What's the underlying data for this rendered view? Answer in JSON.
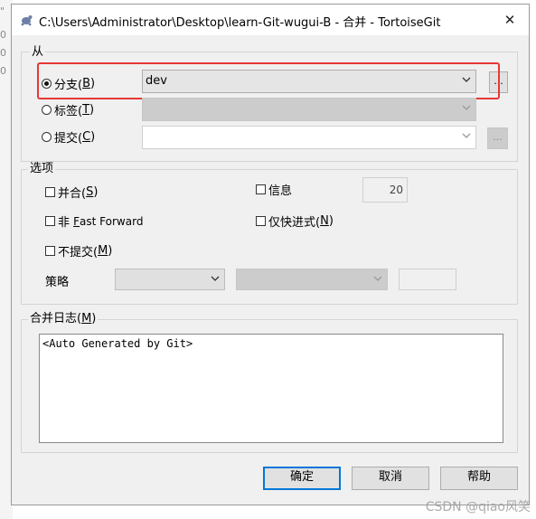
{
  "background": {
    "fragments": [
      "\"",
      "0",
      "0",
      "0"
    ]
  },
  "window": {
    "title": "C:\\Users\\Administrator\\Desktop\\learn-Git-wugui-B - 合并 - TortoiseGit",
    "close_glyph": "✕"
  },
  "from_group": {
    "label": "从",
    "branch": {
      "label": "分支(",
      "mnemonic": "B",
      "suffix": ")",
      "selected": true,
      "value": "dev",
      "browse": "..."
    },
    "tag": {
      "label": "标签(",
      "mnemonic": "T",
      "suffix": ")",
      "selected": false
    },
    "commit": {
      "label": "提交(",
      "mnemonic": "C",
      "suffix": ")",
      "selected": false,
      "browse": "..."
    }
  },
  "options_group": {
    "label": "选项",
    "squash": {
      "label": "并合(",
      "mnemonic": "S",
      "suffix": ")",
      "checked": false
    },
    "no_ff": {
      "label_prefix": "非 ",
      "mnemonic": "F",
      "label_rest": "ast Forward",
      "checked": false
    },
    "no_commit": {
      "label": "不提交(",
      "mnemonic": "M",
      "suffix": ")",
      "checked": false
    },
    "log": {
      "label": "信息",
      "checked": false,
      "value": "20"
    },
    "ff_only": {
      "label": "仅快进式(",
      "mnemonic": "N",
      "suffix": ")",
      "checked": false
    },
    "strategy_label": "策略"
  },
  "merge_log": {
    "label": "合并日志(",
    "mnemonic": "M",
    "suffix": ")",
    "text": "<Auto Generated by Git>"
  },
  "buttons": {
    "ok": "确定",
    "cancel": "取消",
    "help": "帮助"
  },
  "watermark": "CSDN @qiao风笑"
}
